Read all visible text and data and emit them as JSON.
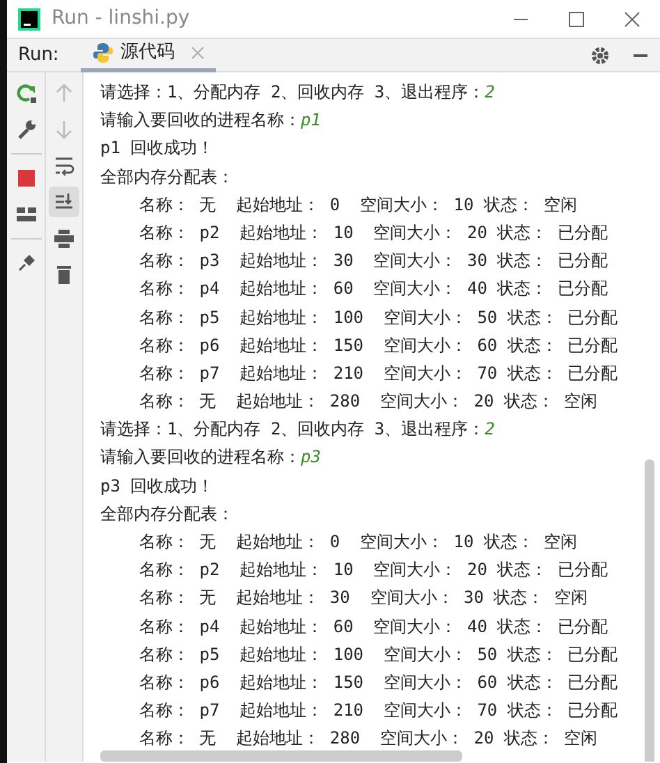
{
  "window": {
    "title": "Run - linshi.py"
  },
  "run_bar": {
    "label": "Run:",
    "tabs": [
      {
        "label": "源代码",
        "selected": true
      }
    ]
  },
  "left_toolbar": [
    {
      "kind": "rerun"
    },
    {
      "kind": "wrench"
    },
    {
      "kind": "stop"
    },
    {
      "kind": "layout"
    },
    {
      "kind": "pin"
    }
  ],
  "console_toolbar": [
    {
      "kind": "up",
      "disabled": true,
      "selected": false
    },
    {
      "kind": "down",
      "disabled": true,
      "selected": false
    },
    {
      "kind": "wrap",
      "disabled": false,
      "selected": false
    },
    {
      "kind": "scroll-end",
      "disabled": false,
      "selected": true
    },
    {
      "kind": "print",
      "disabled": false,
      "selected": false
    },
    {
      "kind": "trash",
      "disabled": false,
      "selected": false
    }
  ],
  "console": {
    "lines": [
      {
        "kind": "input",
        "text": "请选择：1、分配内存 2、回收内存 3、退出程序：",
        "input": "2"
      },
      {
        "kind": "input",
        "text": "请输入要回收的进程名称：",
        "input": "p1"
      },
      {
        "kind": "text",
        "text": "p1 回收成功！"
      },
      {
        "kind": "text",
        "text": "全部内存分配表："
      },
      {
        "kind": "row",
        "text": "名称： 无  起始地址： 0  空间大小： 10 状态： 空闲"
      },
      {
        "kind": "row",
        "text": "名称： p2  起始地址： 10  空间大小： 20 状态： 已分配"
      },
      {
        "kind": "row",
        "text": "名称： p3  起始地址： 30  空间大小： 30 状态： 已分配"
      },
      {
        "kind": "row",
        "text": "名称： p4  起始地址： 60  空间大小： 40 状态： 已分配"
      },
      {
        "kind": "row",
        "text": "名称： p5  起始地址： 100  空间大小： 50 状态： 已分配"
      },
      {
        "kind": "row",
        "text": "名称： p6  起始地址： 150  空间大小： 60 状态： 已分配"
      },
      {
        "kind": "row",
        "text": "名称： p7  起始地址： 210  空间大小： 70 状态： 已分配"
      },
      {
        "kind": "row",
        "text": "名称： 无  起始地址： 280  空间大小： 20 状态： 空闲"
      },
      {
        "kind": "input",
        "text": "请选择：1、分配内存 2、回收内存 3、退出程序：",
        "input": "2"
      },
      {
        "kind": "input",
        "text": "请输入要回收的进程名称：",
        "input": "p3"
      },
      {
        "kind": "text",
        "text": "p3 回收成功！"
      },
      {
        "kind": "text",
        "text": "全部内存分配表："
      },
      {
        "kind": "row",
        "text": "名称： 无  起始地址： 0  空间大小： 10 状态： 空闲"
      },
      {
        "kind": "row",
        "text": "名称： p2  起始地址： 10  空间大小： 20 状态： 已分配"
      },
      {
        "kind": "row",
        "text": "名称： 无  起始地址： 30  空间大小： 30 状态： 空闲"
      },
      {
        "kind": "row",
        "text": "名称： p4  起始地址： 60  空间大小： 40 状态： 已分配"
      },
      {
        "kind": "row",
        "text": "名称： p5  起始地址： 100  空间大小： 50 状态： 已分配"
      },
      {
        "kind": "row",
        "text": "名称： p6  起始地址： 150  空间大小： 60 状态： 已分配"
      },
      {
        "kind": "row",
        "text": "名称： p7  起始地址： 210  空间大小： 70 状态： 已分配"
      },
      {
        "kind": "row",
        "text": "名称： 无  起始地址： 280  空间大小： 20 状态： 空闲"
      }
    ]
  }
}
